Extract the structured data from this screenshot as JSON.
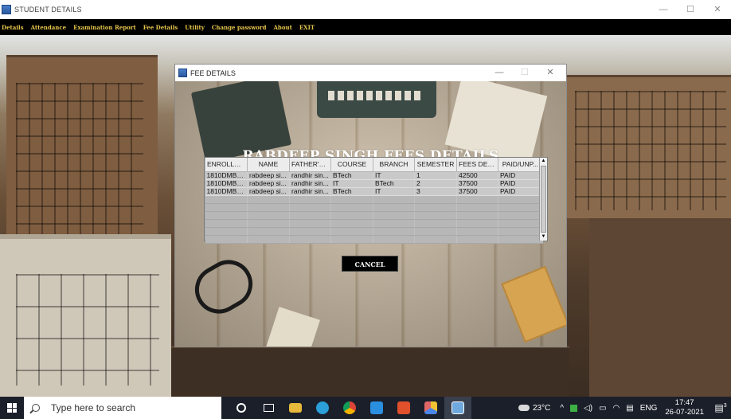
{
  "main_window": {
    "title": "STUDENT DETAILS",
    "controls": {
      "minimize": "—",
      "maximize": "☐",
      "close": "✕"
    }
  },
  "menubar": {
    "items": [
      "Details",
      "Attendance",
      "Examination Report",
      "Fee Details",
      "Utility",
      "Change password",
      "About",
      "EXIT"
    ]
  },
  "dialog": {
    "title": "FEE DETAILS",
    "controls": {
      "minimize": "—",
      "maximize": "☐",
      "close": "✕"
    },
    "heading": "RABDEEP SINGH FEES DETAILS",
    "table": {
      "columns": [
        "ENROLLM...",
        "NAME",
        "FATHER'S ...",
        "COURSE",
        "BRANCH",
        "SEMESTER",
        "FEES DEP...",
        "PAID/UNP..."
      ],
      "rows": [
        [
          "1810DMB4...",
          "rabdeep si...",
          "randhir sin...",
          "BTech",
          "IT",
          "1",
          "42500",
          "PAID"
        ],
        [
          "1810DMB4...",
          "rabdeep si...",
          "randhir sin...",
          "IT",
          "BTech",
          "2",
          "37500",
          "PAID"
        ],
        [
          "1810DMB4...",
          "rabdeep si...",
          "randhir sin...",
          "BTech",
          "IT",
          "3",
          "37500",
          "PAID"
        ]
      ],
      "scroll_up": "▲",
      "scroll_down": "▼"
    },
    "cancel_label": "CANCEL"
  },
  "taskbar": {
    "search_placeholder": "Type here to search",
    "icons": [
      "cortana-icon",
      "task-view-icon",
      "file-explorer-icon",
      "edge-icon",
      "chrome-icon",
      "vscode-icon",
      "office-icon",
      "app-icon",
      "java-app-icon"
    ],
    "temperature": "23°C",
    "language": "ENG",
    "time": "17:47",
    "date": "26-07-2021",
    "notification_count": "3"
  }
}
